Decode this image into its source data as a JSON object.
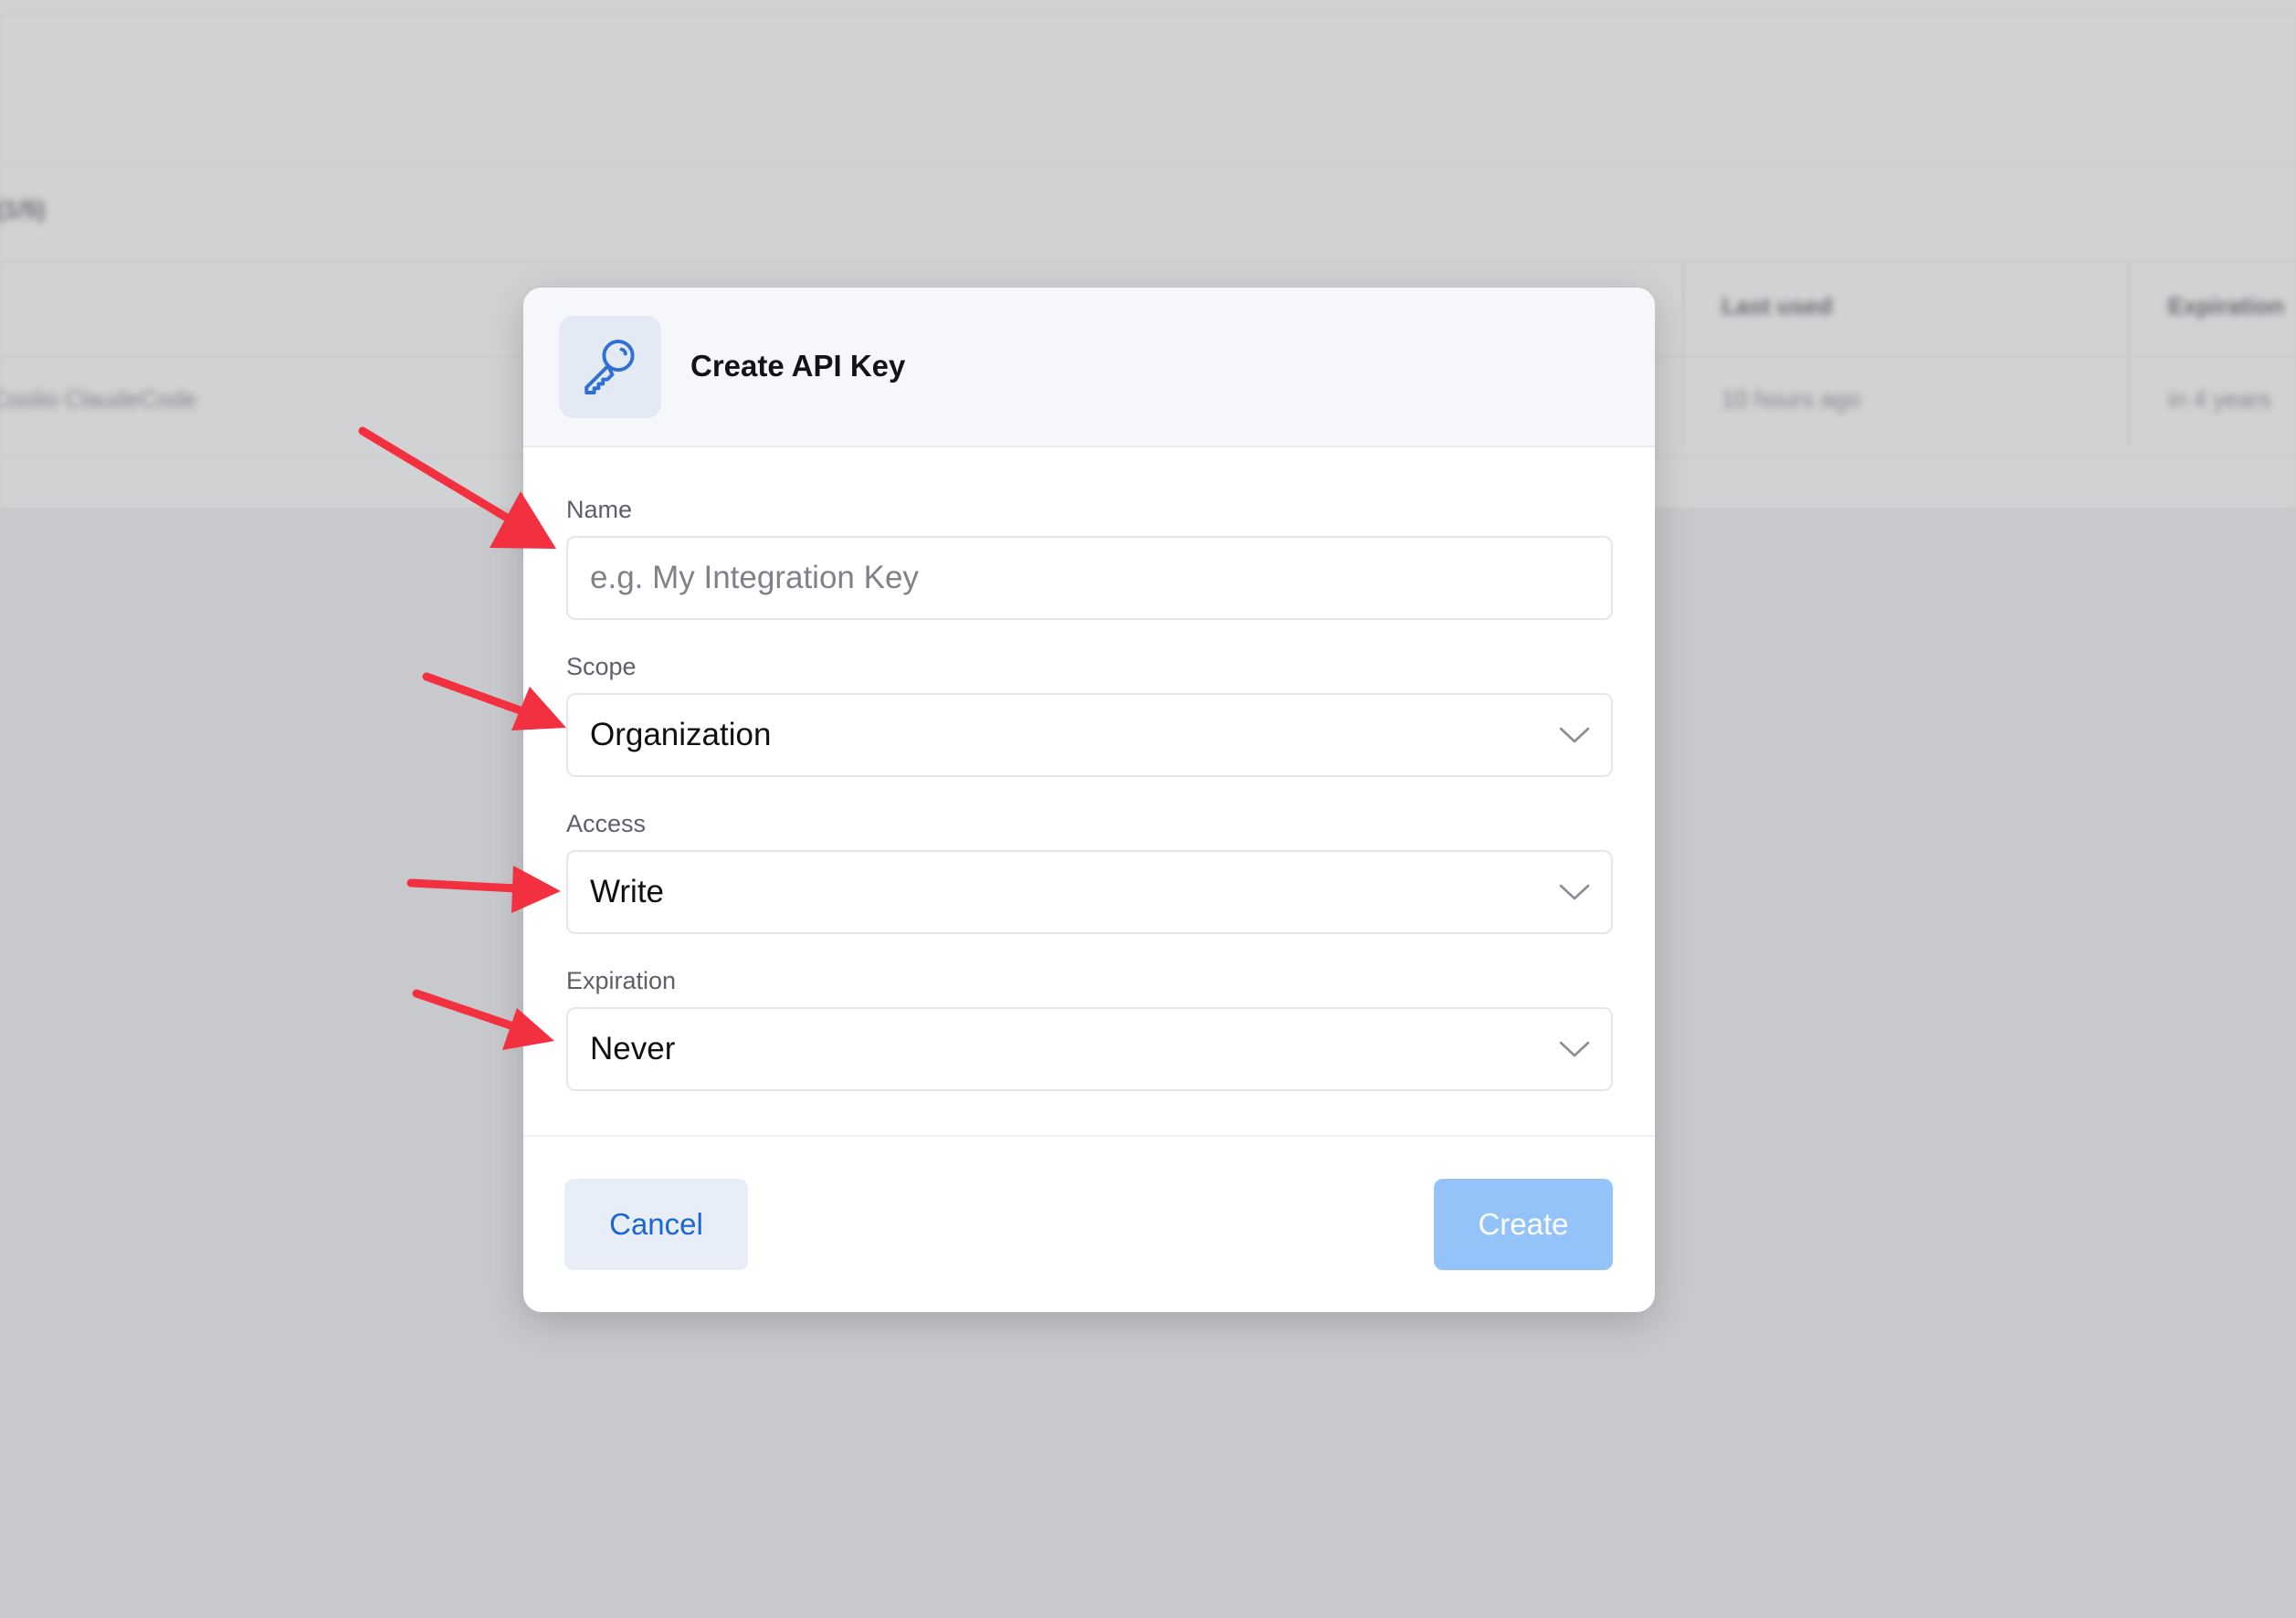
{
  "background": {
    "table_columns": [
      "Last used",
      "Expiration"
    ],
    "row_cells": [
      "Coolio ClaudeCode",
      "10 hours ago",
      "in 4 years"
    ],
    "section_title": "(1/5)"
  },
  "modal": {
    "title": "Create API Key",
    "icon": "key-icon",
    "fields": {
      "name": {
        "label": "Name",
        "value": "",
        "placeholder": "e.g. My Integration Key"
      },
      "scope": {
        "label": "Scope",
        "value": "Organization"
      },
      "access": {
        "label": "Access",
        "value": "Write"
      },
      "expiration": {
        "label": "Expiration",
        "value": "Never"
      }
    },
    "buttons": {
      "cancel": "Cancel",
      "create": "Create"
    }
  },
  "annotations": {
    "arrow_color": "#f2303f",
    "arrow_count": 4
  },
  "colors": {
    "accent": "#1b66d1",
    "create_button_disabled": "#94c3fa",
    "overlay": "#c8c9cc"
  }
}
